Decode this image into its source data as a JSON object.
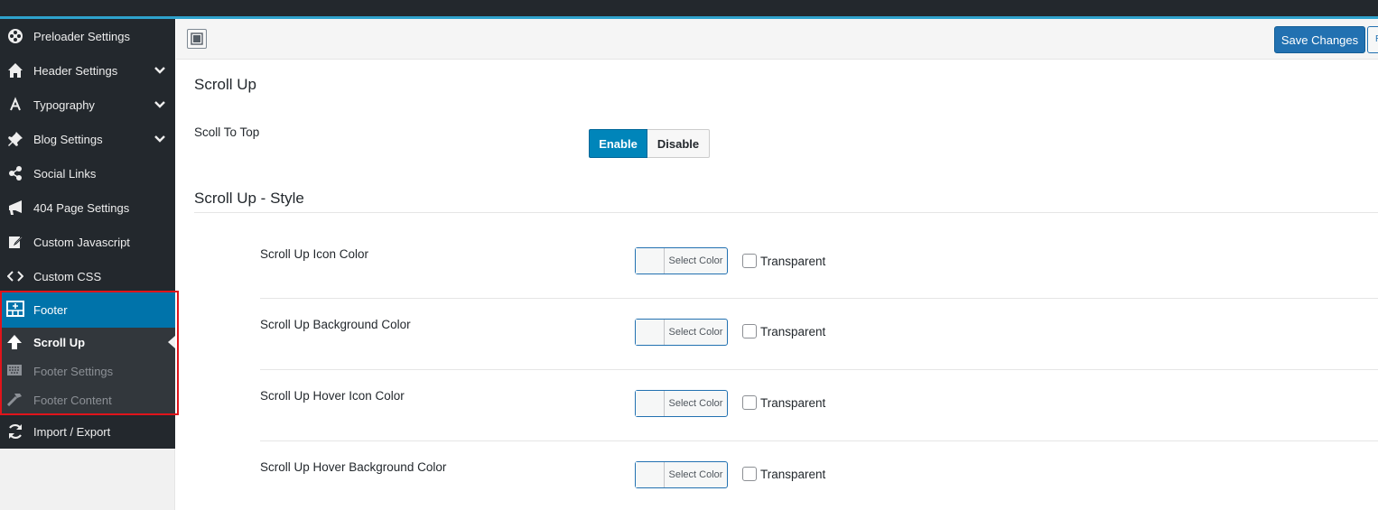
{
  "sidebar": {
    "items": [
      {
        "label": "Preloader Settings",
        "icon": "wheel-icon"
      },
      {
        "label": "Header Settings",
        "icon": "home-icon",
        "has_children": true
      },
      {
        "label": "Typography",
        "icon": "letter-a-icon",
        "has_children": true
      },
      {
        "label": "Blog Settings",
        "icon": "pin-icon",
        "has_children": true
      },
      {
        "label": "Social Links",
        "icon": "share-icon"
      },
      {
        "label": "404 Page Settings",
        "icon": "megaphone-icon"
      },
      {
        "label": "Custom Javascript",
        "icon": "edit-icon"
      },
      {
        "label": "Custom CSS",
        "icon": "code-icon"
      }
    ],
    "active": {
      "label": "Footer",
      "icon": "footer-grid-icon"
    },
    "submenu": [
      {
        "label": "Scroll Up",
        "icon": "arrow-up-icon",
        "current": true
      },
      {
        "label": "Footer Settings",
        "icon": "keyboard-icon"
      },
      {
        "label": "Footer Content",
        "icon": "hammer-icon"
      }
    ],
    "after": {
      "label": "Import / Export",
      "icon": "refresh-icon"
    }
  },
  "toolbar": {
    "save_label": "Save Changes",
    "reset_label": "R"
  },
  "main": {
    "section_title": "Scroll Up",
    "scroll_to_top": {
      "label": "Scoll To Top",
      "enable_label": "Enable",
      "disable_label": "Disable",
      "selected": "Enable"
    },
    "style_title": "Scroll Up - Style",
    "color_fields": [
      {
        "label": "Scroll Up Icon Color",
        "button": "Select Color",
        "transparent": "Transparent"
      },
      {
        "label": "Scroll Up Background Color",
        "button": "Select Color",
        "transparent": "Transparent"
      },
      {
        "label": "Scroll Up Hover Icon Color",
        "button": "Select Color",
        "transparent": "Transparent"
      },
      {
        "label": "Scroll Up Hover Background Color",
        "button": "Select Color",
        "transparent": "Transparent"
      }
    ]
  },
  "colors": {
    "sidebar_bg": "#23282d",
    "active_bg": "#0073aa",
    "accent": "#2ea2cc",
    "primary_button": "#2271b1",
    "highlight_border": "#e0141b"
  }
}
